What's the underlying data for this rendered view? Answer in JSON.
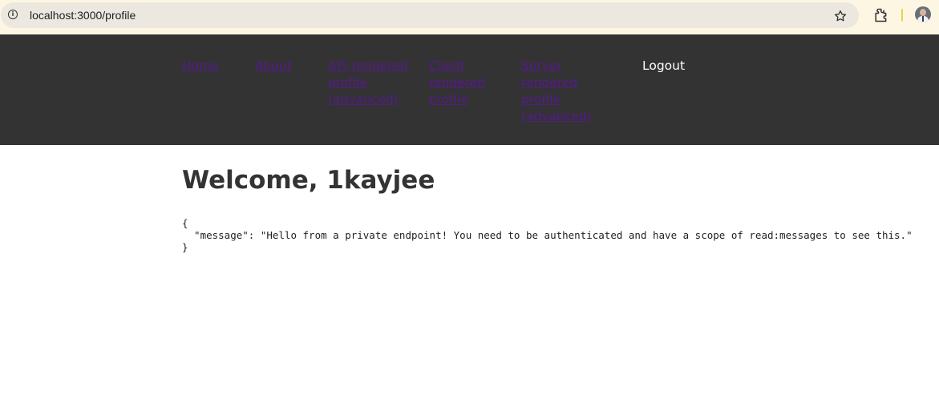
{
  "browser": {
    "url": "localhost:3000/profile",
    "site_info_glyph": "i",
    "icons": [
      "site-info-icon",
      "star-icon",
      "extensions-icon",
      "avatar"
    ]
  },
  "nav": {
    "home": "Home",
    "about": "About",
    "api_profile": "API rendered profile (advanced)",
    "client_profile": "Client rendered profile",
    "server_profile": "Server rendered profile (advanced)",
    "logout": "Logout",
    "link_color": "#551a8b",
    "bg_color": "#333333"
  },
  "main": {
    "title": "Welcome, 1kayjee",
    "json_open": "{",
    "json_line": "  \"message\": \"Hello from a private endpoint! You need to be authenticated and have a scope of read:messages to see this.\"",
    "json_close": "}"
  }
}
